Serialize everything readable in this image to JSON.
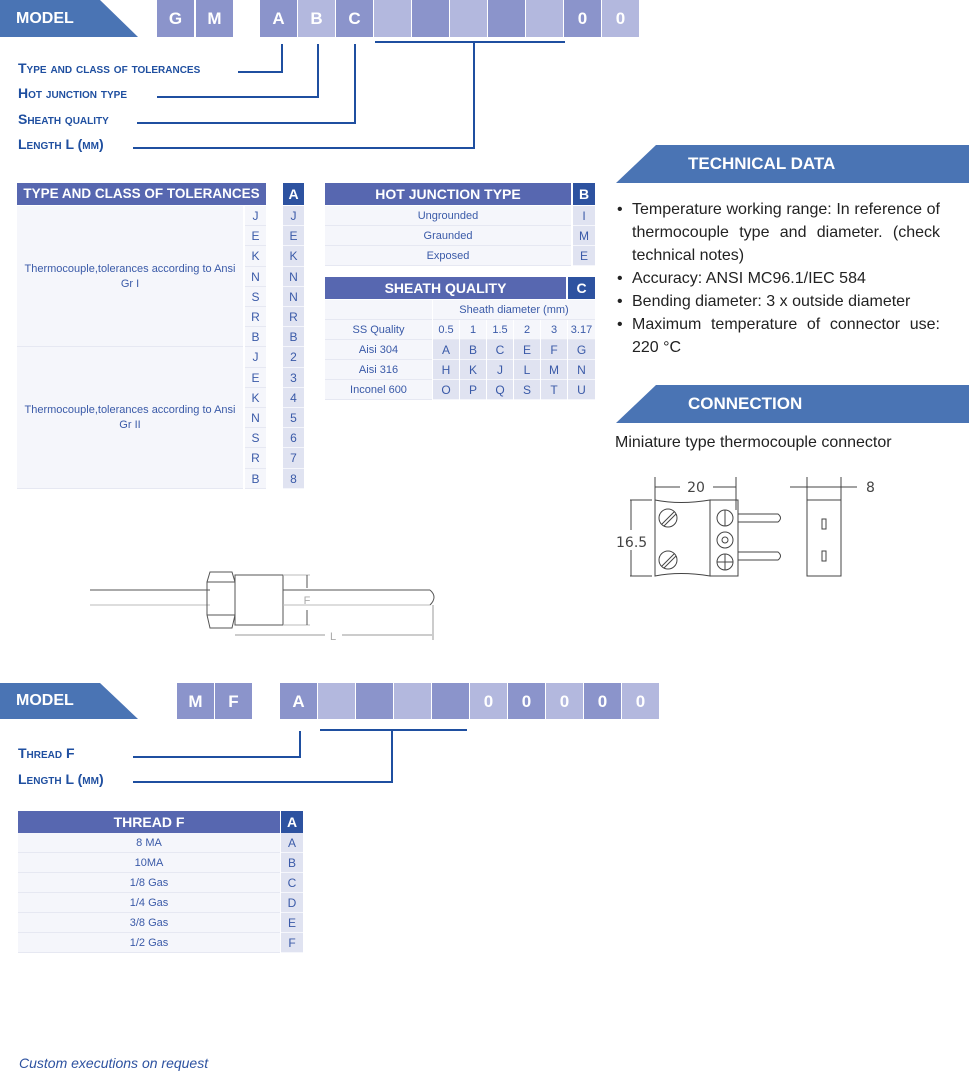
{
  "model1": {
    "label": "MODEL",
    "prefix": [
      "G",
      "M"
    ],
    "code_cells": [
      "A",
      "B",
      "C",
      "",
      "",
      "",
      "",
      "",
      "0",
      "0"
    ],
    "legend": [
      {
        "label": "Type and class of tolerances",
        "code": "A"
      },
      {
        "label": "Hot junction type",
        "code": "B"
      },
      {
        "label": "Sheath quality",
        "code": "C"
      },
      {
        "label": "Length L (mm)",
        "code": "L"
      }
    ]
  },
  "tolerances_table": {
    "header": "TYPE AND CLASS OF TOLERANCES",
    "code_header": "A",
    "groups": [
      {
        "description": "Thermocouple,tolerances according to Ansi Gr I",
        "rows": [
          {
            "type": "J",
            "code": "J"
          },
          {
            "type": "E",
            "code": "E"
          },
          {
            "type": "K",
            "code": "K"
          },
          {
            "type": "N",
            "code": "N"
          },
          {
            "type": "S",
            "code": "N"
          },
          {
            "type": "R",
            "code": "R"
          },
          {
            "type": "B",
            "code": "B"
          }
        ]
      },
      {
        "description": "Thermocouple,tolerances according to Ansi Gr II",
        "rows": [
          {
            "type": "J",
            "code": "2"
          },
          {
            "type": "E",
            "code": "3"
          },
          {
            "type": "K",
            "code": "4"
          },
          {
            "type": "N",
            "code": "5"
          },
          {
            "type": "S",
            "code": "6"
          },
          {
            "type": "R",
            "code": "7"
          },
          {
            "type": "B",
            "code": "8"
          }
        ]
      }
    ]
  },
  "hot_junction_table": {
    "header": "HOT JUNCTION TYPE",
    "code_header": "B",
    "rows": [
      {
        "label": "Ungrounded",
        "code": "I"
      },
      {
        "label": "Graunded",
        "code": "M"
      },
      {
        "label": "Exposed",
        "code": "E"
      }
    ]
  },
  "sheath_table": {
    "header": "SHEATH QUALITY",
    "code_header": "C",
    "subheader": "Sheath diameter (mm)",
    "row_header": "SS Quality",
    "diameters": [
      "0.5",
      "1",
      "1.5",
      "2",
      "3",
      "3.17"
    ],
    "rows": [
      {
        "quality": "Aisi 304",
        "codes": [
          "A",
          "B",
          "C",
          "E",
          "F",
          "G"
        ]
      },
      {
        "quality": "Aisi 316",
        "codes": [
          "H",
          "K",
          "J",
          "L",
          "M",
          "N"
        ]
      },
      {
        "quality": "Inconel 600",
        "codes": [
          "O",
          "P",
          "Q",
          "S",
          "T",
          "U"
        ]
      }
    ]
  },
  "technical_data": {
    "title": "TECHNICAL DATA",
    "items": [
      "Temperature working range: In reference of thermocouple type and diameter. (check technical notes)",
      "Accuracy: ANSI MC96.1/IEC 584",
      "Bending diameter: 3 x outside diameter",
      "Maximum temperature of connector use: 220 °C"
    ]
  },
  "connection": {
    "title": "CONNECTION",
    "description": "Miniature type thermocouple connector",
    "dims": {
      "width": "20",
      "height": "16.5",
      "depth": "8"
    }
  },
  "probe_drawing": {
    "thread_label": "F",
    "length_label": "L"
  },
  "model2": {
    "label": "MODEL",
    "prefix": [
      "M",
      "F"
    ],
    "code_cells": [
      "A",
      "",
      "",
      "",
      "",
      "0",
      "0",
      "0",
      "0",
      "0"
    ],
    "legend": [
      {
        "label": "Thread F",
        "code": "A"
      },
      {
        "label": "Length L (mm)",
        "code": "L"
      }
    ]
  },
  "thread_table": {
    "header": "THREAD F",
    "code_header": "A",
    "rows": [
      {
        "label": "8 MA",
        "code": "A"
      },
      {
        "label": "10MA",
        "code": "B"
      },
      {
        "label": "1/8 Gas",
        "code": "C"
      },
      {
        "label": "1/4 Gas",
        "code": "D"
      },
      {
        "label": "3/8 Gas",
        "code": "E"
      },
      {
        "label": "1/2 Gas",
        "code": "F"
      }
    ]
  },
  "footer": "Custom executions on request",
  "colors": {
    "accent": "#4a74b4",
    "header": "#5767b0",
    "code_header": "#2d52a0",
    "cell_dark": "#8b94cb",
    "cell_light": "#b3b8de",
    "text_blue": "#1f4fa0"
  }
}
